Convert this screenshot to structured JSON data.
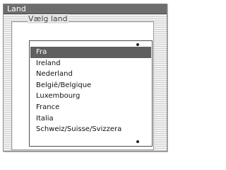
{
  "window": {
    "title": "Land"
  },
  "group": {
    "label": "Vælg land"
  },
  "list": {
    "selected_index": 0,
    "items": [
      "Fra",
      "Ireland",
      "Nederland",
      "België/Belgique",
      "Luxembourg",
      "France",
      "Italia",
      "Schweiz/Suisse/Svizzera"
    ]
  },
  "colors": {
    "title_bar": "#6d6d6d",
    "selection": "#5f5f5f"
  }
}
